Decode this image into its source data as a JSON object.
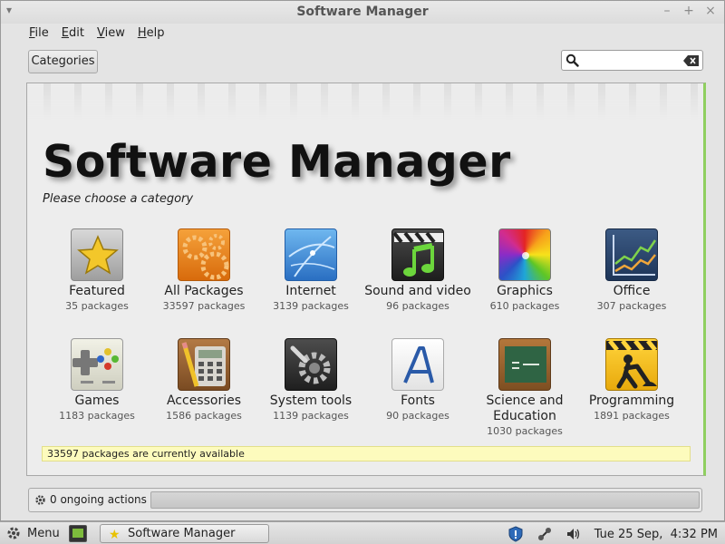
{
  "window": {
    "title": "Software Manager"
  },
  "menu": {
    "file": "ile",
    "file_key": "F",
    "edit": "dit",
    "edit_key": "E",
    "view": "iew",
    "view_key": "V",
    "help": "elp",
    "help_key": "H"
  },
  "toolbar": {
    "categories_label": "Categories",
    "search_value": ""
  },
  "main": {
    "title": "Software Manager",
    "subtitle": "Please choose a category",
    "categories": [
      {
        "name": "Featured",
        "count": "35 packages",
        "icon": "star-icon"
      },
      {
        "name": "All Packages",
        "count": "33597 packages",
        "icon": "gears-icon"
      },
      {
        "name": "Internet",
        "count": "3139 packages",
        "icon": "globe-icon"
      },
      {
        "name": "Sound and video",
        "count": "96 packages",
        "icon": "music-icon"
      },
      {
        "name": "Graphics",
        "count": "610 packages",
        "icon": "color-wheel-icon"
      },
      {
        "name": "Office",
        "count": "307 packages",
        "icon": "chart-icon"
      },
      {
        "name": "Games",
        "count": "1183 packages",
        "icon": "gamepad-icon"
      },
      {
        "name": "Accessories",
        "count": "1586 packages",
        "icon": "calculator-icon"
      },
      {
        "name": "System tools",
        "count": "1139 packages",
        "icon": "system-gear-icon"
      },
      {
        "name": "Fonts",
        "count": "90 packages",
        "icon": "font-icon"
      },
      {
        "name": "Science and Education",
        "count": "1030 packages",
        "icon": "chalkboard-icon"
      },
      {
        "name": "Programming",
        "count": "1891 packages",
        "icon": "construction-icon"
      }
    ],
    "status": "33597 packages are currently available"
  },
  "actions": {
    "label": "0 ongoing actions"
  },
  "panel": {
    "menu_label": "Menu",
    "task_label": "Software Manager",
    "clock": "Tue 25 Sep,  4:32 PM"
  }
}
